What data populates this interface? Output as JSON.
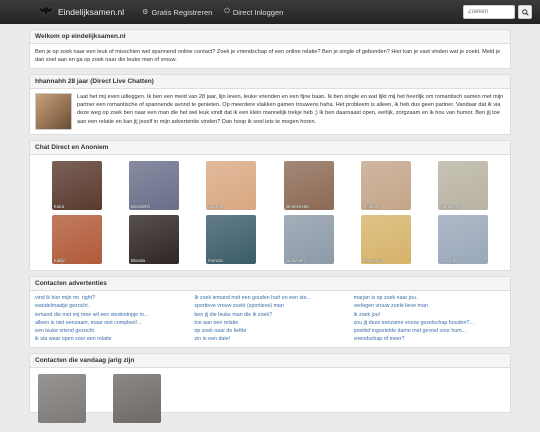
{
  "nav": {
    "brand": "Eindelijksamen.nl",
    "register": "Gratis Registreren",
    "login": "Direct Inloggen",
    "search_placeholder": "Zoeken"
  },
  "welcome": {
    "title": "Welkom op eindelijksamen.nl",
    "text": "Ben je op zoek naar een leuk of misschien wel spannend online contact? Zoek je vriendschap of een online relatie? Ben je single of gebonden? Hier kan je vast vinden wat je zoekt. Meld je dan snel aan en ga op zoek naar die leuke man of vrouw."
  },
  "chat": {
    "title": "hhannahh 28 jaar (Direct Live Chatten)",
    "text": "Laat het mij even uitleggen. Ik ben een meid van 28 jaar, lijn leven, leuke vrienden en een fijne baan. Ik ben single en wat lijkt mij het heerlijk om romantisch samen met mijn partner een romantische of spannende avond te genieten. Op meerdere vlakken gamen trouwens haha. Het probleem is alleen, ik heb dus geen partner. Vandaar dat ik via deze weg op zoek ben naar een man die het wel leuk vindt dat ik een klein mannelijk trekje heb ;) Ik ben daarnaast open, eerlijk, zorgzaam en ik hou van humor. Ben jij toe aan een relatie en kan jij jezelf in mijn advertentie vinden? Dan hoop ik snel iets te mogen horen."
  },
  "chat_direct": {
    "title": "Chat Direct en Anoniem",
    "profiles": [
      {
        "name": "Kaira",
        "color": "#5a3a2e"
      },
      {
        "name": "Blondehh",
        "color": "#6a6f8a"
      },
      {
        "name": "annetje",
        "color": "#d9a882"
      },
      {
        "name": "jannekes56",
        "color": "#8c6a54"
      },
      {
        "name": "vlekeloe",
        "color": "#c4a58a"
      },
      {
        "name": "Nanosexe",
        "color": "#b8b3a2"
      },
      {
        "name": "Katlijn",
        "color": "#b15a38"
      },
      {
        "name": "Blonda",
        "color": "#2e2622"
      },
      {
        "name": "leoncia",
        "color": "#3b5c6a"
      },
      {
        "name": "juristavan",
        "color": "#8d9aa8"
      },
      {
        "name": "eeuwijnzo",
        "color": "#d6b36a"
      },
      {
        "name": "marzjak",
        "color": "#9aa8ba"
      }
    ]
  },
  "ads": {
    "title": "Contacten advertenties",
    "col1": [
      "vind ik hier mijn mr. right?",
      "wandelmaatje gezocht.",
      "iemand die met mij mee wil een stedentripje m...",
      "alleen is niet eenzaam, maar niet compleet!...",
      "een leuke vriend gezocht.",
      "ik sta waar open voor een relatie"
    ],
    "col2": [
      "Ik zoek iemand met een gouden hart en een ste...",
      "sportieve vrouw zoekt (sportieve) man",
      "ben jij die leuke man die ik zoek?",
      "toe aan een relatie",
      "op zoek naar de liefde",
      "zin in een date!"
    ],
    "col3": [
      "marjan is op zoek naar jou.",
      "verlegen vrouw zoekt lieve man",
      "ik zoek jou!",
      "zou jij deze eenzame vrouw gezelschap houden?...",
      "positief ingestelde dame met gevoel voor hum...",
      "vriendschap of meer?"
    ]
  },
  "birthdays": {
    "title": "Contacten die vandaag jarig zijn",
    "profiles": [
      {
        "name": "",
        "color": "#7d7a78"
      },
      {
        "name": "",
        "color": "#6f6a66"
      }
    ]
  },
  "colors": {
    "navbar": "#2b2b2b",
    "link": "#3a6fa8",
    "panel_header": "#f5f5f5"
  }
}
